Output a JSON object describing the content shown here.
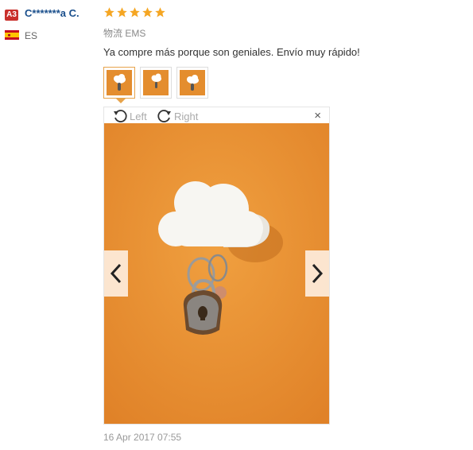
{
  "reviewer": {
    "badge": "A3",
    "name": "C*******a C.",
    "country": "ES",
    "flag_icon": "spain-flag-icon"
  },
  "review": {
    "rating": 5,
    "rating_max": 5,
    "shipping": "物流 EMS",
    "text": "Ya compre más porque son geniales. Envío muy rápido!",
    "date": "16 Apr 2017 07:55"
  },
  "thumbnails": [
    {
      "label": "photo-1",
      "active": true
    },
    {
      "label": "photo-2",
      "active": false
    },
    {
      "label": "photo-3",
      "active": false
    }
  ],
  "viewer": {
    "rotate_left_label": "Left",
    "rotate_right_label": "Right",
    "close_label": "×"
  },
  "colors": {
    "star": "#f5a623",
    "username": "#1a4f8c",
    "photo_bg": "#e48d2e",
    "badge": "#c9302c"
  }
}
